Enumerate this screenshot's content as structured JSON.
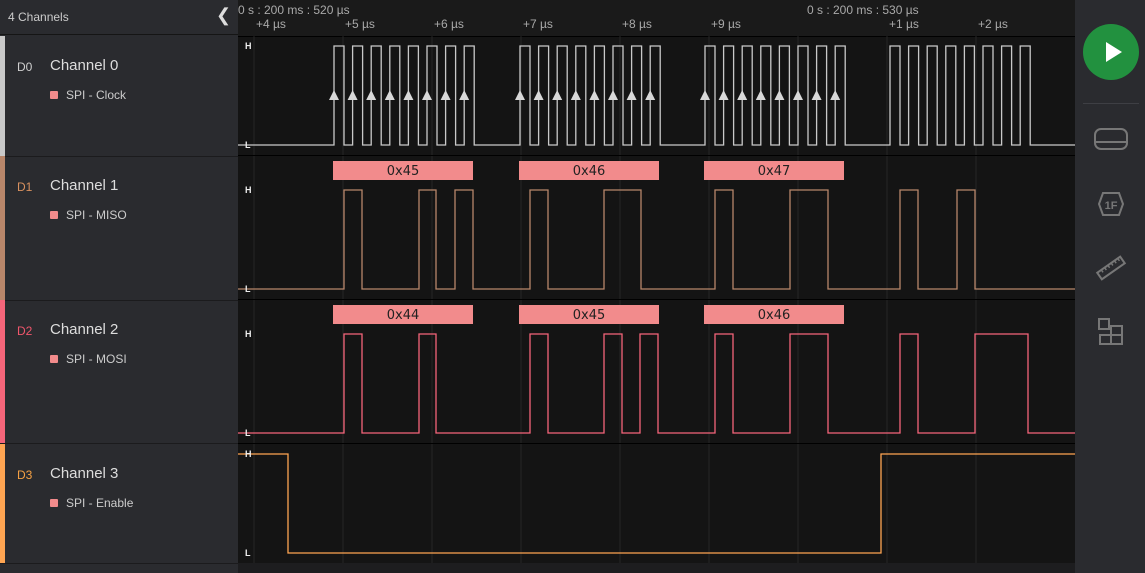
{
  "sidebar": {
    "title": "4 Channels",
    "collapse_icon": "chevron-left-icon"
  },
  "channels": [
    {
      "id": "D0",
      "name": "Channel 0",
      "analyzer": "SPI - Clock",
      "color": "#c9c9c9",
      "id_color": "#cfcfcf"
    },
    {
      "id": "D1",
      "name": "Channel 1",
      "analyzer": "SPI - MISO",
      "color": "#b8866a",
      "id_color": "#d9915f"
    },
    {
      "id": "D2",
      "name": "Channel 2",
      "analyzer": "SPI - MOSI",
      "color": "#f5657a",
      "id_color": "#f0566c"
    },
    {
      "id": "D3",
      "name": "Channel 3",
      "analyzer": "SPI - Enable",
      "color": "#ffa552",
      "id_color": "#f5a043"
    }
  ],
  "analyzer_color": "#f28b8c",
  "timeline": {
    "left_anchor": "0 s : 200 ms : 520 µs",
    "right_anchor": "0 s : 200 ms : 530 µs",
    "ticks": [
      "+4 µs",
      "+5 µs",
      "+6 µs",
      "+7 µs",
      "+8 µs",
      "+9 µs",
      "",
      "+1 µs",
      "+2 µs"
    ]
  },
  "levels": {
    "high": "H",
    "low": "L"
  },
  "decoded": {
    "miso": [
      "0x45",
      "0x46",
      "0x47"
    ],
    "mosi": [
      "0x44",
      "0x45",
      "0x46"
    ]
  },
  "toolbar": {
    "play": "play-icon",
    "tools": [
      "device-icon",
      "analyzer-1f-icon",
      "ruler-measure-icon",
      "extensions-icon"
    ],
    "play_color": "#22913f"
  }
}
